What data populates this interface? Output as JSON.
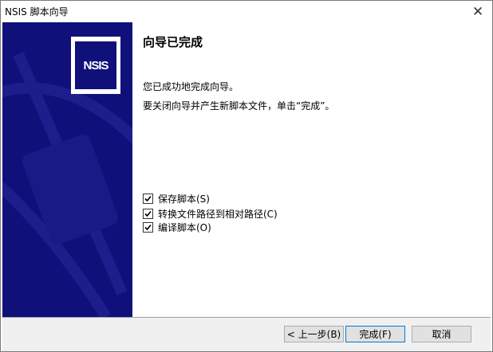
{
  "window": {
    "title": "NSIS 脚本向导"
  },
  "sidebar": {
    "logo_text": "NSIS"
  },
  "content": {
    "heading": "向导已完成",
    "line1": "您已成功地完成向导。",
    "line2": "要关闭向导并产生新脚本文件，单击“完成”。",
    "options": [
      {
        "label": "保存脚本(S)",
        "checked": true
      },
      {
        "label": "转换文件路径到相对路径(C)",
        "checked": true
      },
      {
        "label": "编译脚本(O)",
        "checked": true
      }
    ]
  },
  "footer": {
    "back_label": "< 上一步(B)",
    "finish_label": "完成(F)",
    "cancel_label": "取消"
  },
  "colors": {
    "sidebar_bg": "#10107a",
    "accent": "#0078d7"
  }
}
